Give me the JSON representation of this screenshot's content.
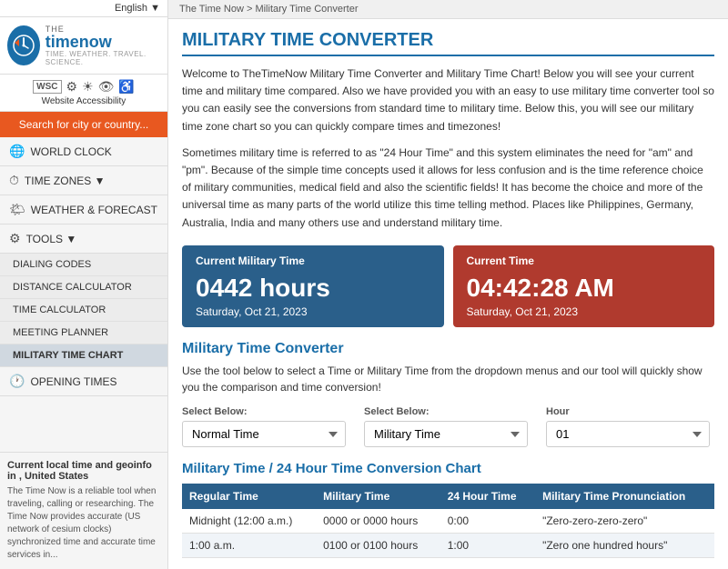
{
  "lang": {
    "label": "English",
    "dropdown_icon": "▼"
  },
  "logo": {
    "the": "THE",
    "name": "timenow",
    "tagline": "TIME. WEATHER. TRAVEL. SCIENCE.",
    "icon": "🕐"
  },
  "accessibility": {
    "wsc": "WSC",
    "icons": [
      "⚙",
      "☉",
      "👁",
      "◉"
    ],
    "label": "Website Accessibility"
  },
  "search": {
    "placeholder": "Search for city or country..."
  },
  "nav": [
    {
      "id": "world-clock",
      "icon": "🌐",
      "label": "WORLD CLOCK"
    },
    {
      "id": "time-zones",
      "icon": "⏱",
      "label": "TIME ZONES ▼"
    },
    {
      "id": "weather",
      "icon": "🌤",
      "label": "WEATHER & FORECAST"
    },
    {
      "id": "tools",
      "icon": "⚙",
      "label": "TOOLS ▼"
    }
  ],
  "sub_nav": [
    {
      "id": "dialing-codes",
      "label": "DIALING CODES"
    },
    {
      "id": "distance-calculator",
      "label": "DISTANCE CALCULATOR"
    },
    {
      "id": "time-calculator",
      "label": "TIME CALCULATOR"
    },
    {
      "id": "meeting-planner",
      "label": "MEETING PLANNER"
    },
    {
      "id": "military-time-chart",
      "label": "MILITARY TIME CHART",
      "active": true
    }
  ],
  "opening_times": {
    "icon": "🕐",
    "label": "OPENING TIMES"
  },
  "local_info": {
    "title": "Current local time and geoinfo in , United States",
    "text": "The Time Now is a reliable tool when traveling, calling or researching. The Time Now provides accurate (US network of cesium clocks) synchronized time and accurate time services in..."
  },
  "breadcrumb": "The Time Now > Military Time Converter",
  "page_title": "MILITARY TIME CONVERTER",
  "intro_p1": "Welcome to TheTimeNow Military Time Converter and Military Time Chart! Below you will see your current time and military time compared. Also we have provided you with an easy to use military time converter tool so you can easily see the conversions from standard time to military time. Below this, you will see our military time zone chart so you can quickly compare times and timezones!",
  "intro_p2": "Sometimes military time is referred to as \"24 Hour Time\" and this system eliminates the need for \"am\" and \"pm\". Because of the simple time concepts used it allows for less confusion and is the time reference choice of military communities, medical field and also the scientific fields! It has become the choice and more of the universal time as many parts of the world utilize this time telling method. Places like Philippines, Germany, Australia, India and many others use and understand military time.",
  "military_box": {
    "header": "Current Military Time",
    "time": "0442 hours",
    "date": "Saturday, Oct 21, 2023"
  },
  "current_box": {
    "header": "Current Time",
    "time": "04:42:28 AM",
    "date": "Saturday, Oct 21, 2023"
  },
  "converter": {
    "title": "Military Time Converter",
    "description": "Use the tool below to select a Time or Military Time from the dropdown menus and our tool will quickly show you the comparison and time conversion!",
    "select_label_1": "Select Below:",
    "select_label_2": "Select Below:",
    "dropdown_1_value": "Normal Time",
    "dropdown_2_value": "Military Time",
    "dropdown_1_options": [
      "Normal Time",
      "Military Time"
    ],
    "dropdown_2_options": [
      "Military Time",
      "Normal Time"
    ],
    "hour_label": "Hour"
  },
  "chart": {
    "title": "Military Time / 24 Hour Time Conversion Chart",
    "headers": [
      "Regular Time",
      "Military Time",
      "24 Hour Time",
      "Military Time Pronunciation"
    ],
    "rows": [
      [
        "Midnight (12:00 a.m.)",
        "0000 or 0000 hours",
        "0:00",
        "\"Zero-zero-zero-zero\""
      ],
      [
        "1:00 a.m.",
        "0100 or 0100 hours",
        "1:00",
        "\"Zero one hundred hours\""
      ]
    ]
  }
}
